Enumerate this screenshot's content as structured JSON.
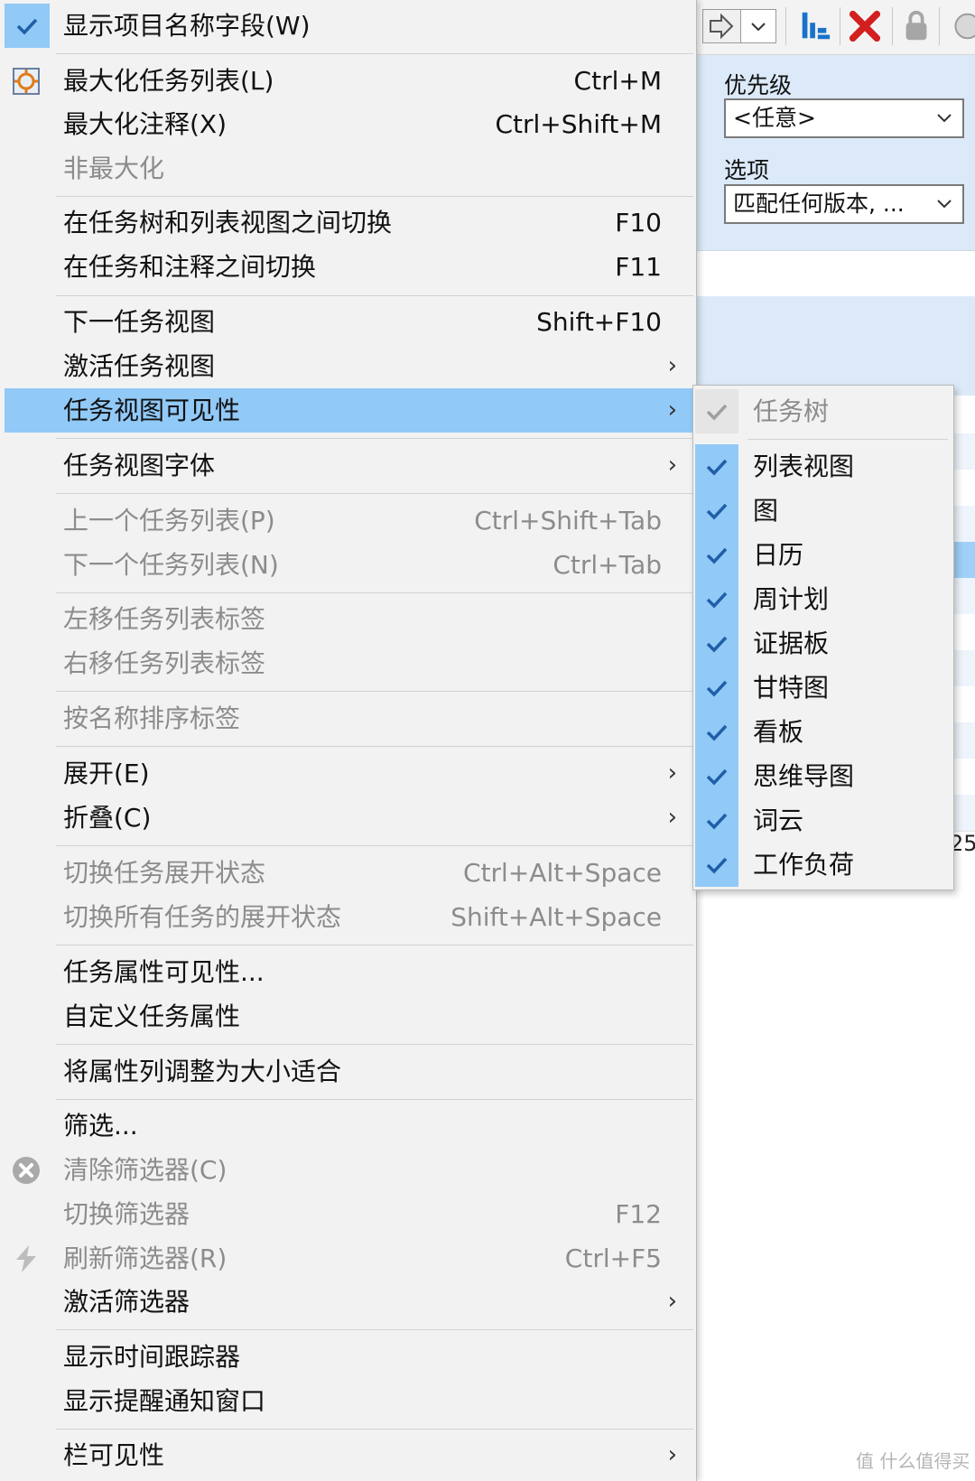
{
  "background": {
    "filter_panel": {
      "priority_label": "优先级",
      "priority_value": "<任意>",
      "options_label": "选项",
      "options_value": "匹配任何版本, ..."
    },
    "fragment_number": "25"
  },
  "main_menu": {
    "items": [
      {
        "label": "显示项目名称字段(W)",
        "shortcut": "",
        "checked": true
      },
      {
        "label": "最大化任务列表(L)",
        "shortcut": "Ctrl+M",
        "icon": "maximize-icon"
      },
      {
        "label": "最大化注释(X)",
        "shortcut": "Ctrl+Shift+M"
      },
      {
        "label": "非最大化",
        "shortcut": "",
        "disabled": true
      },
      {
        "label": "在任务树和列表视图之间切换",
        "shortcut": "F10"
      },
      {
        "label": "在任务和注释之间切换",
        "shortcut": "F11"
      },
      {
        "label": "下一任务视图",
        "shortcut": "Shift+F10"
      },
      {
        "label": "激活任务视图",
        "submenu": true
      },
      {
        "label": "任务视图可见性",
        "submenu": true,
        "highlighted": true
      },
      {
        "label": "任务视图字体",
        "submenu": true
      },
      {
        "label": "上一个任务列表(P)",
        "shortcut": "Ctrl+Shift+Tab",
        "disabled": true
      },
      {
        "label": "下一个任务列表(N)",
        "shortcut": "Ctrl+Tab",
        "disabled": true
      },
      {
        "label": "左移任务列表标签",
        "disabled": true
      },
      {
        "label": "右移任务列表标签",
        "disabled": true
      },
      {
        "label": "按名称排序标签",
        "disabled": true
      },
      {
        "label": "展开(E)",
        "submenu": true
      },
      {
        "label": "折叠(C)",
        "submenu": true
      },
      {
        "label": "切换任务展开状态",
        "shortcut": "Ctrl+Alt+Space",
        "disabled": true
      },
      {
        "label": "切换所有任务的展开状态",
        "shortcut": "Shift+Alt+Space",
        "disabled": true
      },
      {
        "label": "任务属性可见性..."
      },
      {
        "label": "自定义任务属性"
      },
      {
        "label": "将属性列调整为大小适合"
      },
      {
        "label": "筛选..."
      },
      {
        "label": "清除筛选器(C)",
        "disabled": true,
        "icon": "clear-filter-icon"
      },
      {
        "label": "切换筛选器",
        "shortcut": "F12",
        "disabled": true
      },
      {
        "label": "刷新筛选器(R)",
        "shortcut": "Ctrl+F5",
        "disabled": true,
        "icon": "refresh-filter-icon"
      },
      {
        "label": "激活筛选器",
        "submenu": true
      },
      {
        "label": "显示时间跟踪器"
      },
      {
        "label": "显示提醒通知窗口"
      },
      {
        "label": "栏可见性",
        "submenu": true
      }
    ]
  },
  "submenu": {
    "items": [
      {
        "label": "任务树",
        "checked": true,
        "disabled": true
      },
      {
        "label": "列表视图",
        "checked": true
      },
      {
        "label": "图",
        "checked": true
      },
      {
        "label": "日历",
        "checked": true
      },
      {
        "label": "周计划",
        "checked": true
      },
      {
        "label": "证据板",
        "checked": true
      },
      {
        "label": "甘特图",
        "checked": true
      },
      {
        "label": "看板",
        "checked": true
      },
      {
        "label": "思维导图",
        "checked": true
      },
      {
        "label": "词云",
        "checked": true
      },
      {
        "label": "工作负荷",
        "checked": true
      }
    ]
  },
  "watermark": "值 什么值得买",
  "colors": {
    "highlight": "#91c9f7",
    "menu_bg": "#f2f2f2",
    "panel_blue": "#dbe9f8",
    "disabled_text": "#8c8c8c",
    "check": "#1f5fa8"
  }
}
